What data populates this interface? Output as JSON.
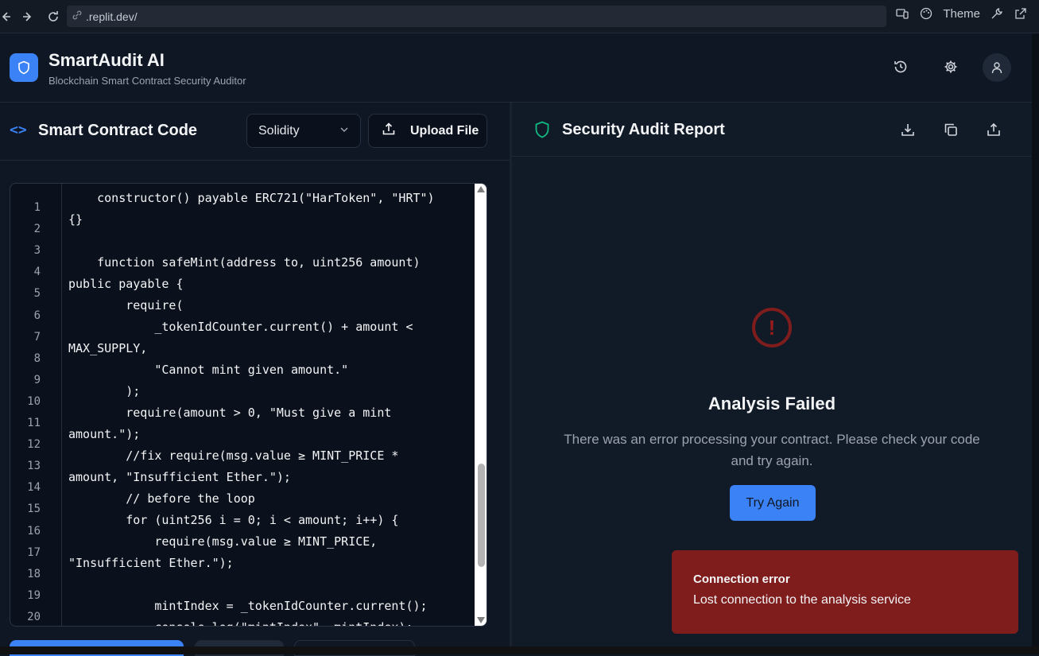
{
  "browser": {
    "url": ".replit.dev/",
    "theme_label": "Theme"
  },
  "header": {
    "title": "SmartAudit AI",
    "subtitle": "Blockchain Smart Contract Security Auditor"
  },
  "editor_panel": {
    "title": "Smart Contract Code",
    "language_selected": "Solidity",
    "upload_label": "Upload File",
    "line_numbers": [
      "1",
      "2",
      "3",
      "4",
      "5",
      "6",
      "7",
      "8",
      "9",
      "10",
      "11",
      "12",
      "13",
      "14",
      "15",
      "16",
      "17",
      "18",
      "19",
      "20"
    ],
    "code_lines": [
      "    constructor() payable ERC721(\"HarToken\", \"HRT\")",
      "{}",
      "",
      "    function safeMint(address to, uint256 amount)",
      "public payable {",
      "        require(",
      "            _tokenIdCounter.current() + amount <",
      "MAX_SUPPLY,",
      "            \"Cannot mint given amount.\"",
      "        );",
      "        require(amount > 0, \"Must give a mint",
      "amount.\");",
      "        //fix require(msg.value ≥ MINT_PRICE *",
      "amount, \"Insufficient Ether.\");",
      "        // before the loop",
      "        for (uint256 i = 0; i < amount; i++) {",
      "            require(msg.value ≥ MINT_PRICE,",
      "\"Insufficient Ether.\");",
      "",
      "            mintIndex = _tokenIdCounter.current();",
      "            console.log(\"mintIndex\", mintIndex);"
    ]
  },
  "report_panel": {
    "title": "Security Audit Report",
    "status_title": "Analysis Failed",
    "status_message": "There was an error processing your contract. Please check your code and try again.",
    "retry_label": "Try Again"
  },
  "toast": {
    "title": "Connection error",
    "message": "Lost connection to the analysis service"
  },
  "colors": {
    "accent": "#3b82f6",
    "error": "#7f1d1d",
    "success": "#10b981"
  }
}
